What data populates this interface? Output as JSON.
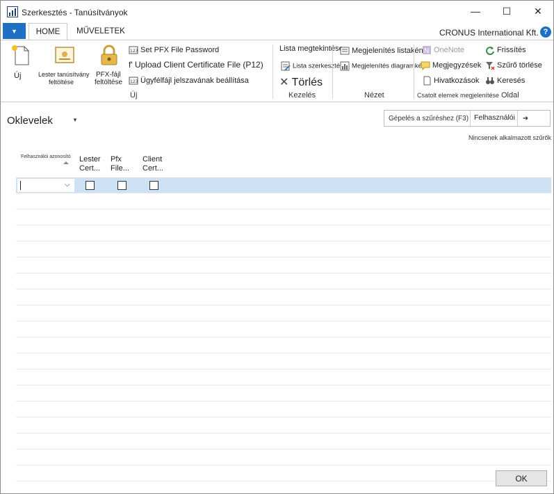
{
  "window": {
    "title": "Szerkesztés - Tanúsítványok",
    "minimize_glyph": "—",
    "maximize_glyph": "☐",
    "close_glyph": "✕"
  },
  "ribbon_tabs": {
    "app_menu_glyph": "▼",
    "home": "HOME",
    "muveletek": "MŰVELETEK",
    "company": "CRONUS International Kft.",
    "help_glyph": "?"
  },
  "ribbon": {
    "uj": {
      "new_label": "Új",
      "upload_lester_label_1": "Lester tanúsítvány",
      "upload_lester_label_2": "feltöltése",
      "pfx_upload_label_1": "PFX-fájl",
      "pfx_upload_label_2": "feltöltése",
      "set_pfx_password": "Set PFX File Password",
      "upload_client_cert": "f' Upload Client Certificate File (P12)",
      "client_password": "Ügyfélfájl jelszavának beállítása",
      "group_label": "Új"
    },
    "kezeles": {
      "view_list": "Lista megtekintése",
      "edit_list": "Lista szerkesztése",
      "delete": "Törlés",
      "group_label": "Kezelés"
    },
    "nezet": {
      "show_as_list": "Megjelenítés listaként",
      "show_as_chart": "Megjelenítés diagramként",
      "group_label": "Nézet"
    },
    "csatolt": {
      "onenote": "OneNote",
      "notes": "Megjegyzések",
      "links": "Hivatkozások",
      "group_label": "Csatolt elemek megjelenítése"
    },
    "oldal": {
      "refresh": "Frissítés",
      "clear_filter": "Szűrő törlése",
      "find": "Keresés",
      "group_label": "Oldal"
    }
  },
  "page": {
    "title": "Oklevelek",
    "title_caret": "▼",
    "search_placeholder": "Gépelés a szűréshez (F3)",
    "search_field": "Felhasználói azonosító",
    "search_go": "➜",
    "no_filters": "Nincsenek alkalmazott szűrők"
  },
  "grid": {
    "columns": {
      "user_id": "Felhasználói azonosító",
      "lester_1": "Lester",
      "lester_2": "Cert...",
      "pfx_1": "Pfx",
      "pfx_2": "File...",
      "client_1": "Client",
      "client_2": "Cert..."
    },
    "dropdown_glyph": "⌵",
    "empty_rows": 18
  },
  "footer": {
    "ok_label": "OK"
  },
  "colors": {
    "accent": "#1f6fc5",
    "selected_row": "#cfe2f3"
  }
}
